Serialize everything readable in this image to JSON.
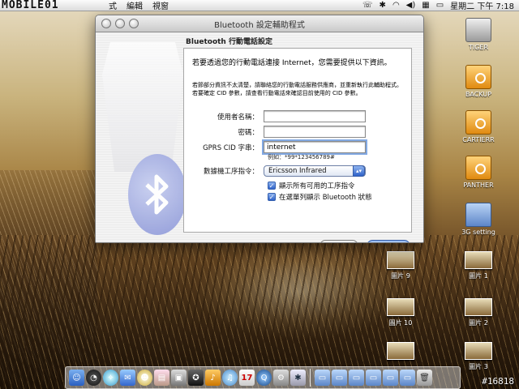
{
  "menubar": {
    "logo": "MOBILE01",
    "items": [
      "式",
      "編輯",
      "視窗"
    ],
    "status_icons": [
      "headset-icon",
      "bluetooth-icon",
      "wifi-icon",
      "volume-icon",
      "flag-icon",
      "battery-icon"
    ],
    "status_glyphs": [
      "☏",
      "✱",
      "◠",
      "◀)",
      "▦",
      "▭"
    ],
    "clock": "星期二 下午 7:18"
  },
  "desktop_icons": [
    {
      "label": "TIGER",
      "kind": "gray-disk"
    },
    {
      "label": "BACKUP",
      "kind": "orange-disk"
    },
    {
      "label": "CARTIERR",
      "kind": "orange-disk"
    },
    {
      "label": "PANTHER",
      "kind": "orange-disk"
    },
    {
      "label": "3G setting",
      "kind": "folder"
    },
    {
      "label": "圖片 9",
      "kind": "thumbnail"
    },
    {
      "label": "圖片 1",
      "kind": "thumbnail"
    },
    {
      "label": "圖片 10",
      "kind": "thumbnail"
    },
    {
      "label": "圖片 2",
      "kind": "thumbnail"
    },
    {
      "label": "圖片 3",
      "kind": "thumbnail"
    }
  ],
  "window": {
    "title": "Bluetooth 設定輔助程式",
    "section_title": "Bluetooth 行動電話設定",
    "intro": "若要透過您的行動電話連接 Internet，您需要提供以下資訊。",
    "note_line1": "若節部分資訊不太清楚，請聯絡您的行動電話服務供應商，並重新執行此輔助程式。",
    "note_line2": "若要確定 CID 參數，請查看行動電話來確認目前使用的 CID 參數。",
    "fields": {
      "username": {
        "label": "使用者名稱：",
        "value": ""
      },
      "password": {
        "label": "密碼：",
        "value": ""
      },
      "gprs_cid": {
        "label": "GPRS CID 字串：",
        "value": "internet",
        "example": "例如：*99*123456789#"
      }
    },
    "modem": {
      "label": "數據機工序指令：",
      "selected": "Ericsson Infrared"
    },
    "checkboxes": [
      {
        "label": "顯示所有可用的工序指令",
        "checked": true
      },
      {
        "label": "在選單列顯示 Bluetooth 狀態",
        "checked": true
      }
    ],
    "buttons": {
      "back": "返回",
      "continue": "繼續"
    }
  },
  "dock": {
    "apps": [
      "finder-icon",
      "dashboard-icon",
      "safari-icon",
      "mail-icon",
      "ichat-icon",
      "preview-icon",
      "iphoto-icon",
      "imovie-icon",
      "garageband-icon",
      "itunes-icon",
      "ical-icon",
      "quicktime-icon",
      "system-preferences-icon",
      "bluetooth-utility-icon"
    ],
    "folders": [
      "applications-folder-icon",
      "documents-folder-icon",
      "downloads-folder-icon",
      "pictures-folder-icon",
      "movies-folder-icon",
      "music-folder-icon",
      "trash-icon"
    ]
  },
  "watermark": "#16818"
}
